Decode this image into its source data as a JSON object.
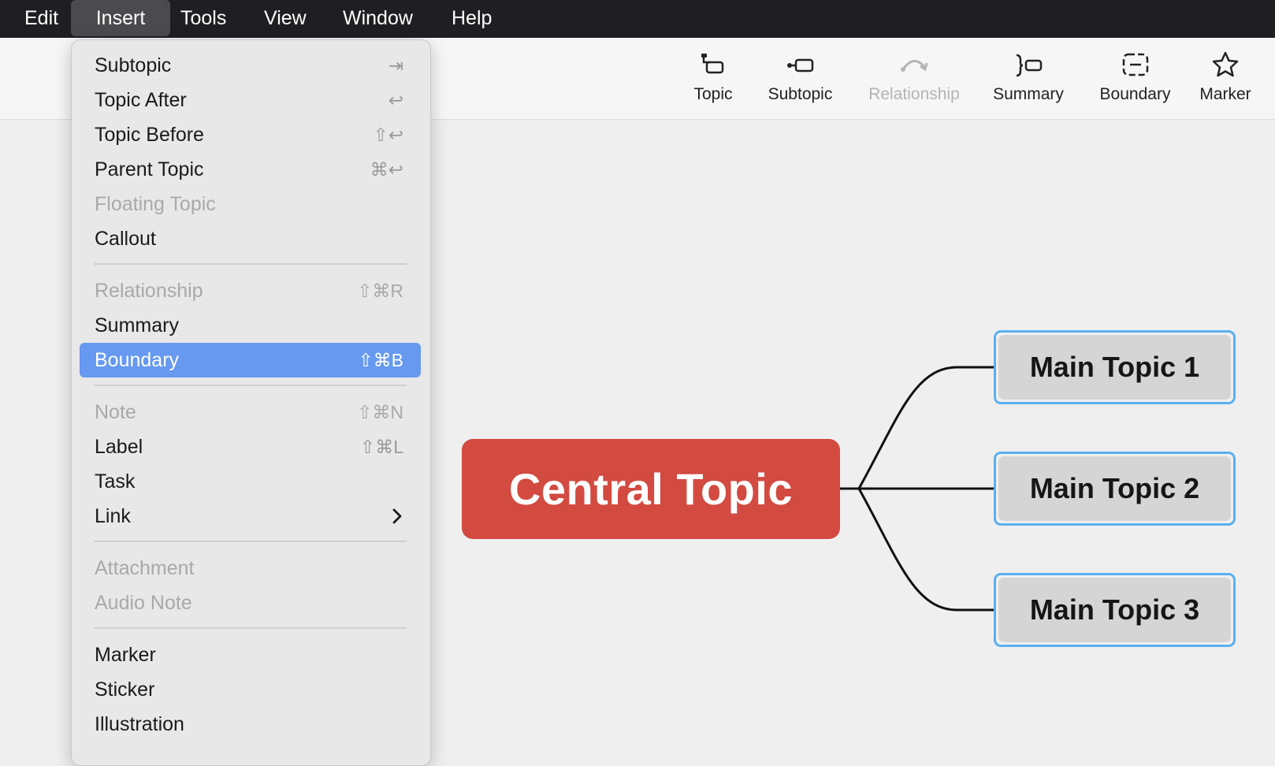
{
  "menubar": {
    "items": [
      "Edit",
      "Insert",
      "Tools",
      "View",
      "Window",
      "Help"
    ],
    "active": "Insert"
  },
  "toolbar": {
    "topic": "Topic",
    "subtopic": "Subtopic",
    "relationship": "Relationship",
    "summary": "Summary",
    "boundary": "Boundary",
    "marker": "Marker"
  },
  "insert_menu": {
    "group1": [
      {
        "label": "Subtopic",
        "shortcut": "⇥",
        "enabled": true
      },
      {
        "label": "Topic After",
        "shortcut": "↩",
        "enabled": true
      },
      {
        "label": "Topic Before",
        "shortcut": "⇧↩",
        "enabled": true
      },
      {
        "label": "Parent Topic",
        "shortcut": "⌘↩",
        "enabled": true
      },
      {
        "label": "Floating Topic",
        "shortcut": "",
        "enabled": false
      },
      {
        "label": "Callout",
        "shortcut": "",
        "enabled": true
      }
    ],
    "group2": [
      {
        "label": "Relationship",
        "shortcut": "⇧⌘R",
        "enabled": false
      },
      {
        "label": "Summary",
        "shortcut": "",
        "enabled": true
      },
      {
        "label": "Boundary",
        "shortcut": "⇧⌘B",
        "enabled": true,
        "selected": true
      }
    ],
    "group3": [
      {
        "label": "Note",
        "shortcut": "⇧⌘N",
        "enabled": false
      },
      {
        "label": "Label",
        "shortcut": "⇧⌘L",
        "enabled": true
      },
      {
        "label": "Task",
        "shortcut": "",
        "enabled": true
      },
      {
        "label": "Link",
        "shortcut": "",
        "enabled": true,
        "submenu": true
      }
    ],
    "group4": [
      {
        "label": "Attachment",
        "shortcut": "",
        "enabled": false
      },
      {
        "label": "Audio Note",
        "shortcut": "",
        "enabled": false
      }
    ],
    "group5": [
      {
        "label": "Marker",
        "shortcut": "",
        "enabled": true
      },
      {
        "label": "Sticker",
        "shortcut": "",
        "enabled": true
      },
      {
        "label": "Illustration",
        "shortcut": "",
        "enabled": true
      }
    ]
  },
  "mindmap": {
    "central_topic": "Central Topic",
    "main_topics": [
      "Main Topic 1",
      "Main Topic 2",
      "Main Topic 3"
    ],
    "central_color": "#d24a40",
    "selection_color": "#5ab0ef"
  },
  "colors": {
    "menu_highlight": "#6699ef",
    "menubar_bg": "#1f1f23"
  }
}
